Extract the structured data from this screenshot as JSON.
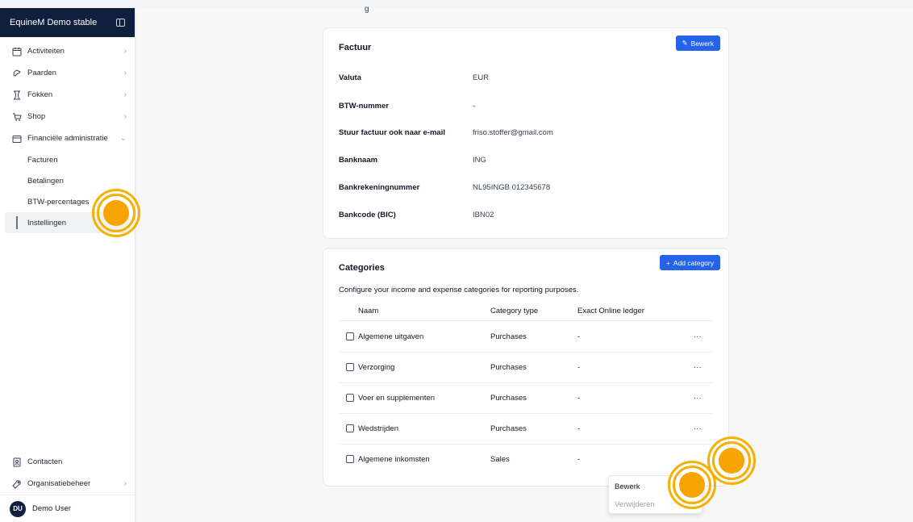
{
  "sidebar": {
    "org_name": "EquineM Demo stable",
    "items": [
      {
        "label": "Activiteiten",
        "icon": "calendar-icon"
      },
      {
        "label": "Paarden",
        "icon": "horse-icon"
      },
      {
        "label": "Fokken",
        "icon": "breeding-icon"
      },
      {
        "label": "Shop",
        "icon": "cart-icon"
      },
      {
        "label": "Financiële administratie",
        "icon": "wallet-icon"
      }
    ],
    "sub_items": [
      {
        "label": "Facturen"
      },
      {
        "label": "Betalingen"
      },
      {
        "label": "BTW-percentages"
      },
      {
        "label": "Instellingen",
        "active": true
      }
    ],
    "bottom_items": [
      {
        "label": "Contacten",
        "icon": "contacts-icon"
      },
      {
        "label": "Organisatiebeheer",
        "icon": "settings-icon"
      }
    ],
    "user": {
      "initials": "DU",
      "name": "Demo User"
    }
  },
  "header": {
    "partial_title": "g"
  },
  "factuur": {
    "title": "Factuur",
    "edit_label": "Bewerk",
    "fields": [
      {
        "label": "Valuta",
        "value": "EUR"
      },
      {
        "label": "BTW-nummer",
        "value": "-"
      },
      {
        "label": "Stuur factuur ook naar e-mail",
        "value": "friso.stoffer@gmail.com"
      },
      {
        "label": "Banknaam",
        "value": "ING"
      },
      {
        "label": "Bankrekeningnummer",
        "value": "NL95INGB 012345678"
      },
      {
        "label": "Bankcode (BIC)",
        "value": "IBN02"
      }
    ]
  },
  "categories": {
    "title": "Categories",
    "add_label": "Add category",
    "description": "Configure your income and expense categories for reporting purposes.",
    "columns": [
      "Naam",
      "Category type",
      "Exact Online ledger"
    ],
    "rows": [
      {
        "name": "Algemene uitgaven",
        "type": "Purchases",
        "ledger": "-"
      },
      {
        "name": "Verzorging",
        "type": "Purchases",
        "ledger": "-"
      },
      {
        "name": "Voer en supplementen",
        "type": "Purchases",
        "ledger": "-"
      },
      {
        "name": "Wedstrijden",
        "type": "Purchases",
        "ledger": "-"
      },
      {
        "name": "Algemene inkomsten",
        "type": "Sales",
        "ledger": "-"
      }
    ],
    "row_menu_label": "..."
  },
  "context_menu": {
    "edit": "Bewerk",
    "delete": "Verwijderen"
  },
  "colors": {
    "brand_dark": "#0f1f3d",
    "primary": "#2563eb",
    "marker": "#f5b000"
  }
}
